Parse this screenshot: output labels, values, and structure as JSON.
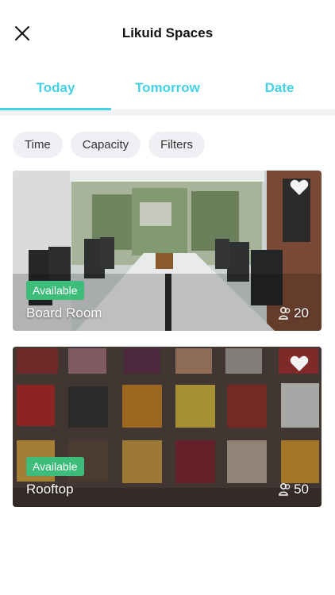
{
  "header": {
    "title": "Likuid Spaces"
  },
  "tabs": [
    {
      "label": "Today"
    },
    {
      "label": "Tomorrow"
    },
    {
      "label": "Date"
    }
  ],
  "filters": [
    {
      "label": "Time"
    },
    {
      "label": "Capacity"
    },
    {
      "label": "Filters"
    }
  ],
  "spaces": [
    {
      "status": "Available",
      "name": "Board Room",
      "capacity": "20"
    },
    {
      "status": "Available",
      "name": "Rooftop",
      "capacity": "50"
    }
  ],
  "colors": {
    "accent": "#43d1e6",
    "available": "#3dbc7a"
  }
}
